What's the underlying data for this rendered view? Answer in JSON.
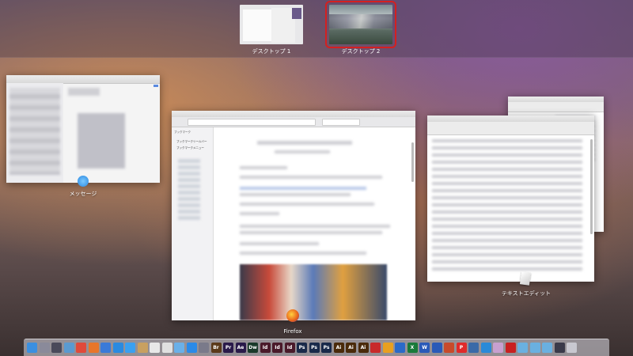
{
  "spaces": [
    {
      "label": "デスクトップ 1",
      "selected": false
    },
    {
      "label": "デスクトップ 2",
      "selected": true
    }
  ],
  "windows": {
    "messages": {
      "label": "メッセージ"
    },
    "firefox": {
      "label": "Firefox",
      "sidebar_title": "ブックマーク",
      "bookmarks_toolbar": "ブックマークツールバー",
      "bookmarks_menu": "ブックマークメニュー"
    },
    "textedit": {
      "label": "テキストエディット"
    }
  },
  "dock": {
    "items": [
      {
        "name": "finder-icon",
        "color": "#3b8fe0",
        "text": ""
      },
      {
        "name": "launchpad-icon",
        "color": "#8a8a9a",
        "text": ""
      },
      {
        "name": "mission-control-icon",
        "color": "#4a4a5a",
        "text": ""
      },
      {
        "name": "preview-icon",
        "color": "#5a9ad0",
        "text": ""
      },
      {
        "name": "chrome-icon",
        "color": "#e04a3a",
        "text": ""
      },
      {
        "name": "firefox-icon",
        "color": "#e8762a",
        "text": ""
      },
      {
        "name": "mail-icon",
        "color": "#3a7ad8",
        "text": ""
      },
      {
        "name": "safari-icon",
        "color": "#2a8ae0",
        "text": ""
      },
      {
        "name": "messages-icon",
        "color": "#3aa0f0",
        "text": ""
      },
      {
        "name": "notes-icon",
        "color": "#c8a060",
        "text": ""
      },
      {
        "name": "textedit-icon",
        "color": "#e8e8e8",
        "text": ""
      },
      {
        "name": "calendar-icon",
        "color": "#e0e0e0",
        "text": ""
      },
      {
        "name": "photos-icon",
        "color": "#6ab0e8",
        "text": ""
      },
      {
        "name": "app-store-icon",
        "color": "#2a8ae8",
        "text": ""
      },
      {
        "name": "settings-icon",
        "color": "#7a7a8a",
        "text": ""
      },
      {
        "name": "bridge-icon",
        "color": "#5a3a1a",
        "text": "Br"
      },
      {
        "name": "premiere-icon",
        "color": "#2a1a4a",
        "text": "Pr"
      },
      {
        "name": "after-effects-icon",
        "color": "#2a1a4a",
        "text": "Ae"
      },
      {
        "name": "dreamweaver-icon",
        "color": "#1a3a2a",
        "text": "Dw"
      },
      {
        "name": "indesign-icon",
        "color": "#4a1a2a",
        "text": "Id"
      },
      {
        "name": "indesign-2-icon",
        "color": "#4a1a2a",
        "text": "Id"
      },
      {
        "name": "indesign-3-icon",
        "color": "#4a1a2a",
        "text": "Id"
      },
      {
        "name": "photoshop-icon",
        "color": "#1a2a4a",
        "text": "Ps"
      },
      {
        "name": "photoshop-2-icon",
        "color": "#1a2a4a",
        "text": "Ps"
      },
      {
        "name": "photoshop-3-icon",
        "color": "#1a2a4a",
        "text": "Ps"
      },
      {
        "name": "illustrator-icon",
        "color": "#4a2a0a",
        "text": "Ai"
      },
      {
        "name": "illustrator-2-icon",
        "color": "#4a2a0a",
        "text": "Ai"
      },
      {
        "name": "illustrator-3-icon",
        "color": "#4a2a0a",
        "text": "Ai"
      },
      {
        "name": "acrobat-icon",
        "color": "#c82a2a",
        "text": ""
      },
      {
        "name": "outlook-icon",
        "color": "#e8a020",
        "text": ""
      },
      {
        "name": "onenote-icon",
        "color": "#2a6ac8",
        "text": ""
      },
      {
        "name": "excel-icon",
        "color": "#1a7a3a",
        "text": "X"
      },
      {
        "name": "word-icon",
        "color": "#2a5ab8",
        "text": "W"
      },
      {
        "name": "word-2-icon",
        "color": "#2a5ab8",
        "text": ""
      },
      {
        "name": "powerpoint-icon",
        "color": "#c84a2a",
        "text": ""
      },
      {
        "name": "p-app-icon",
        "color": "#e02a2a",
        "text": "P"
      },
      {
        "name": "globe-icon",
        "color": "#3a6aa8",
        "text": ""
      },
      {
        "name": "skype-icon",
        "color": "#2a8ad8",
        "text": ""
      },
      {
        "name": "pinwheel-icon",
        "color": "#c8a0d0",
        "text": ""
      },
      {
        "name": "pdf-icon",
        "color": "#c82020",
        "text": ""
      },
      {
        "name": "folder-icon",
        "color": "#6ab0e0",
        "text": ""
      },
      {
        "name": "folder-2-icon",
        "color": "#6ab0e0",
        "text": ""
      },
      {
        "name": "folder-3-icon",
        "color": "#6ab0e0",
        "text": ""
      },
      {
        "name": "screen-icon",
        "color": "#3a3a4a",
        "text": ""
      },
      {
        "name": "trash-icon",
        "color": "#c8c8d0",
        "text": ""
      }
    ]
  }
}
